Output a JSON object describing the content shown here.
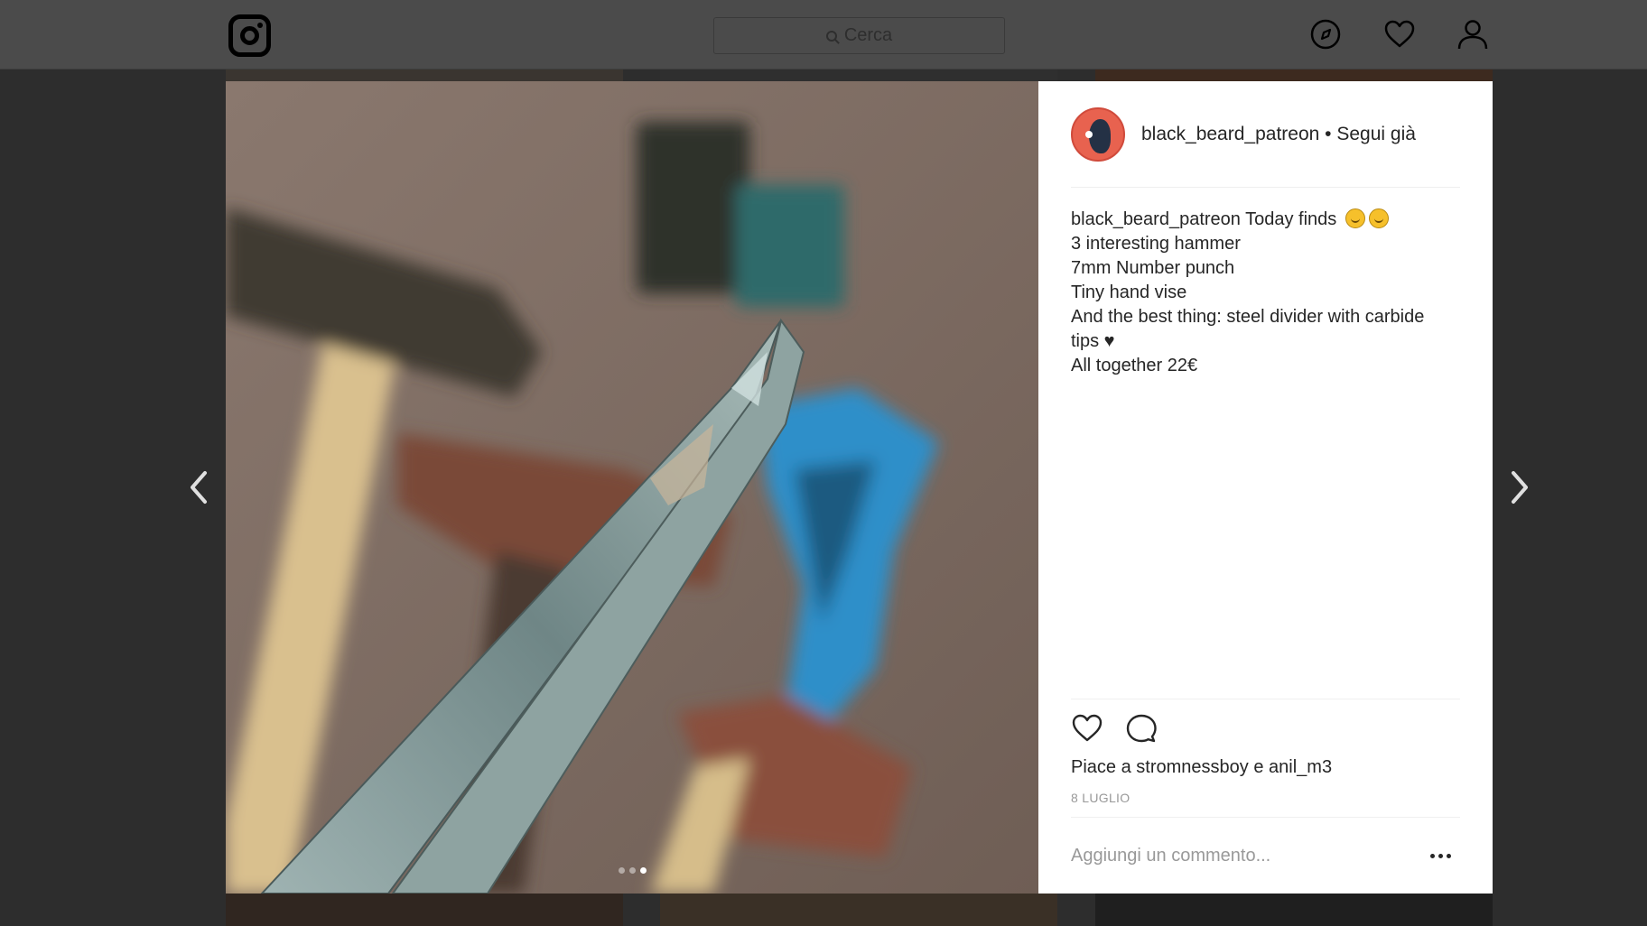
{
  "header": {
    "logo_icon": "instagram-logo-icon",
    "search_placeholder": "Cerca",
    "nav_icons": [
      "compass-icon",
      "heart-icon",
      "profile-icon"
    ]
  },
  "post": {
    "username": "black_beard_patreon",
    "follow_status": "Segui già",
    "caption": {
      "intro": "Today finds",
      "lines": [
        "3 interesting hammer",
        "7mm Number punch",
        "Tiny hand vise",
        "And the best thing: steel divider with carbide",
        "tips ♥",
        "All together 22€"
      ]
    },
    "likes": {
      "prefix": "Piace a",
      "user1": "stromnessboy",
      "conjunction": "e",
      "user2": "anil_m3"
    },
    "date": "8 LUGLIO",
    "comment_placeholder": "Aggiungi un commento...",
    "carousel": {
      "count": 3,
      "active_index": 2
    }
  },
  "colors": {
    "overlay_bg": "#2d2d2d",
    "header_bg": "#4b4b4b",
    "avatar_bg": "#e8624f",
    "divider": "#efefef",
    "muted_text": "#999999"
  }
}
